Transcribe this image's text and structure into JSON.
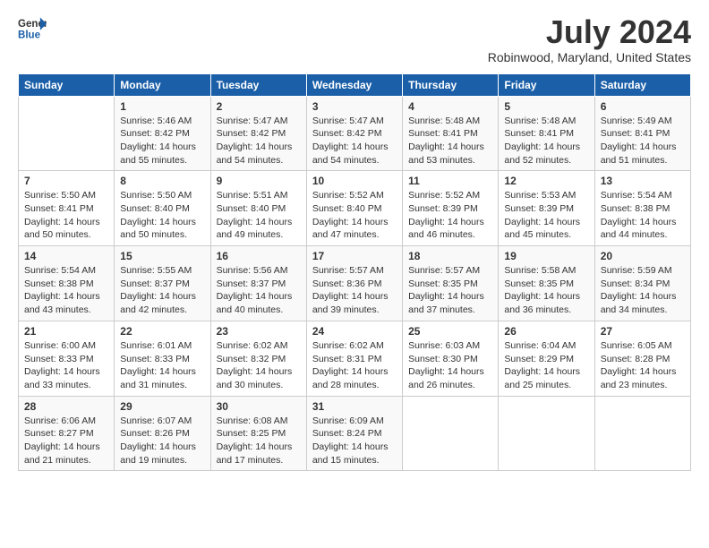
{
  "logo": {
    "line1": "General",
    "line2": "Blue"
  },
  "title": "July 2024",
  "location": "Robinwood, Maryland, United States",
  "weekdays": [
    "Sunday",
    "Monday",
    "Tuesday",
    "Wednesday",
    "Thursday",
    "Friday",
    "Saturday"
  ],
  "weeks": [
    [
      {
        "day": "",
        "info": ""
      },
      {
        "day": "1",
        "info": "Sunrise: 5:46 AM\nSunset: 8:42 PM\nDaylight: 14 hours\nand 55 minutes."
      },
      {
        "day": "2",
        "info": "Sunrise: 5:47 AM\nSunset: 8:42 PM\nDaylight: 14 hours\nand 54 minutes."
      },
      {
        "day": "3",
        "info": "Sunrise: 5:47 AM\nSunset: 8:42 PM\nDaylight: 14 hours\nand 54 minutes."
      },
      {
        "day": "4",
        "info": "Sunrise: 5:48 AM\nSunset: 8:41 PM\nDaylight: 14 hours\nand 53 minutes."
      },
      {
        "day": "5",
        "info": "Sunrise: 5:48 AM\nSunset: 8:41 PM\nDaylight: 14 hours\nand 52 minutes."
      },
      {
        "day": "6",
        "info": "Sunrise: 5:49 AM\nSunset: 8:41 PM\nDaylight: 14 hours\nand 51 minutes."
      }
    ],
    [
      {
        "day": "7",
        "info": "Sunrise: 5:50 AM\nSunset: 8:41 PM\nDaylight: 14 hours\nand 50 minutes."
      },
      {
        "day": "8",
        "info": "Sunrise: 5:50 AM\nSunset: 8:40 PM\nDaylight: 14 hours\nand 50 minutes."
      },
      {
        "day": "9",
        "info": "Sunrise: 5:51 AM\nSunset: 8:40 PM\nDaylight: 14 hours\nand 49 minutes."
      },
      {
        "day": "10",
        "info": "Sunrise: 5:52 AM\nSunset: 8:40 PM\nDaylight: 14 hours\nand 47 minutes."
      },
      {
        "day": "11",
        "info": "Sunrise: 5:52 AM\nSunset: 8:39 PM\nDaylight: 14 hours\nand 46 minutes."
      },
      {
        "day": "12",
        "info": "Sunrise: 5:53 AM\nSunset: 8:39 PM\nDaylight: 14 hours\nand 45 minutes."
      },
      {
        "day": "13",
        "info": "Sunrise: 5:54 AM\nSunset: 8:38 PM\nDaylight: 14 hours\nand 44 minutes."
      }
    ],
    [
      {
        "day": "14",
        "info": "Sunrise: 5:54 AM\nSunset: 8:38 PM\nDaylight: 14 hours\nand 43 minutes."
      },
      {
        "day": "15",
        "info": "Sunrise: 5:55 AM\nSunset: 8:37 PM\nDaylight: 14 hours\nand 42 minutes."
      },
      {
        "day": "16",
        "info": "Sunrise: 5:56 AM\nSunset: 8:37 PM\nDaylight: 14 hours\nand 40 minutes."
      },
      {
        "day": "17",
        "info": "Sunrise: 5:57 AM\nSunset: 8:36 PM\nDaylight: 14 hours\nand 39 minutes."
      },
      {
        "day": "18",
        "info": "Sunrise: 5:57 AM\nSunset: 8:35 PM\nDaylight: 14 hours\nand 37 minutes."
      },
      {
        "day": "19",
        "info": "Sunrise: 5:58 AM\nSunset: 8:35 PM\nDaylight: 14 hours\nand 36 minutes."
      },
      {
        "day": "20",
        "info": "Sunrise: 5:59 AM\nSunset: 8:34 PM\nDaylight: 14 hours\nand 34 minutes."
      }
    ],
    [
      {
        "day": "21",
        "info": "Sunrise: 6:00 AM\nSunset: 8:33 PM\nDaylight: 14 hours\nand 33 minutes."
      },
      {
        "day": "22",
        "info": "Sunrise: 6:01 AM\nSunset: 8:33 PM\nDaylight: 14 hours\nand 31 minutes."
      },
      {
        "day": "23",
        "info": "Sunrise: 6:02 AM\nSunset: 8:32 PM\nDaylight: 14 hours\nand 30 minutes."
      },
      {
        "day": "24",
        "info": "Sunrise: 6:02 AM\nSunset: 8:31 PM\nDaylight: 14 hours\nand 28 minutes."
      },
      {
        "day": "25",
        "info": "Sunrise: 6:03 AM\nSunset: 8:30 PM\nDaylight: 14 hours\nand 26 minutes."
      },
      {
        "day": "26",
        "info": "Sunrise: 6:04 AM\nSunset: 8:29 PM\nDaylight: 14 hours\nand 25 minutes."
      },
      {
        "day": "27",
        "info": "Sunrise: 6:05 AM\nSunset: 8:28 PM\nDaylight: 14 hours\nand 23 minutes."
      }
    ],
    [
      {
        "day": "28",
        "info": "Sunrise: 6:06 AM\nSunset: 8:27 PM\nDaylight: 14 hours\nand 21 minutes."
      },
      {
        "day": "29",
        "info": "Sunrise: 6:07 AM\nSunset: 8:26 PM\nDaylight: 14 hours\nand 19 minutes."
      },
      {
        "day": "30",
        "info": "Sunrise: 6:08 AM\nSunset: 8:25 PM\nDaylight: 14 hours\nand 17 minutes."
      },
      {
        "day": "31",
        "info": "Sunrise: 6:09 AM\nSunset: 8:24 PM\nDaylight: 14 hours\nand 15 minutes."
      },
      {
        "day": "",
        "info": ""
      },
      {
        "day": "",
        "info": ""
      },
      {
        "day": "",
        "info": ""
      }
    ]
  ]
}
